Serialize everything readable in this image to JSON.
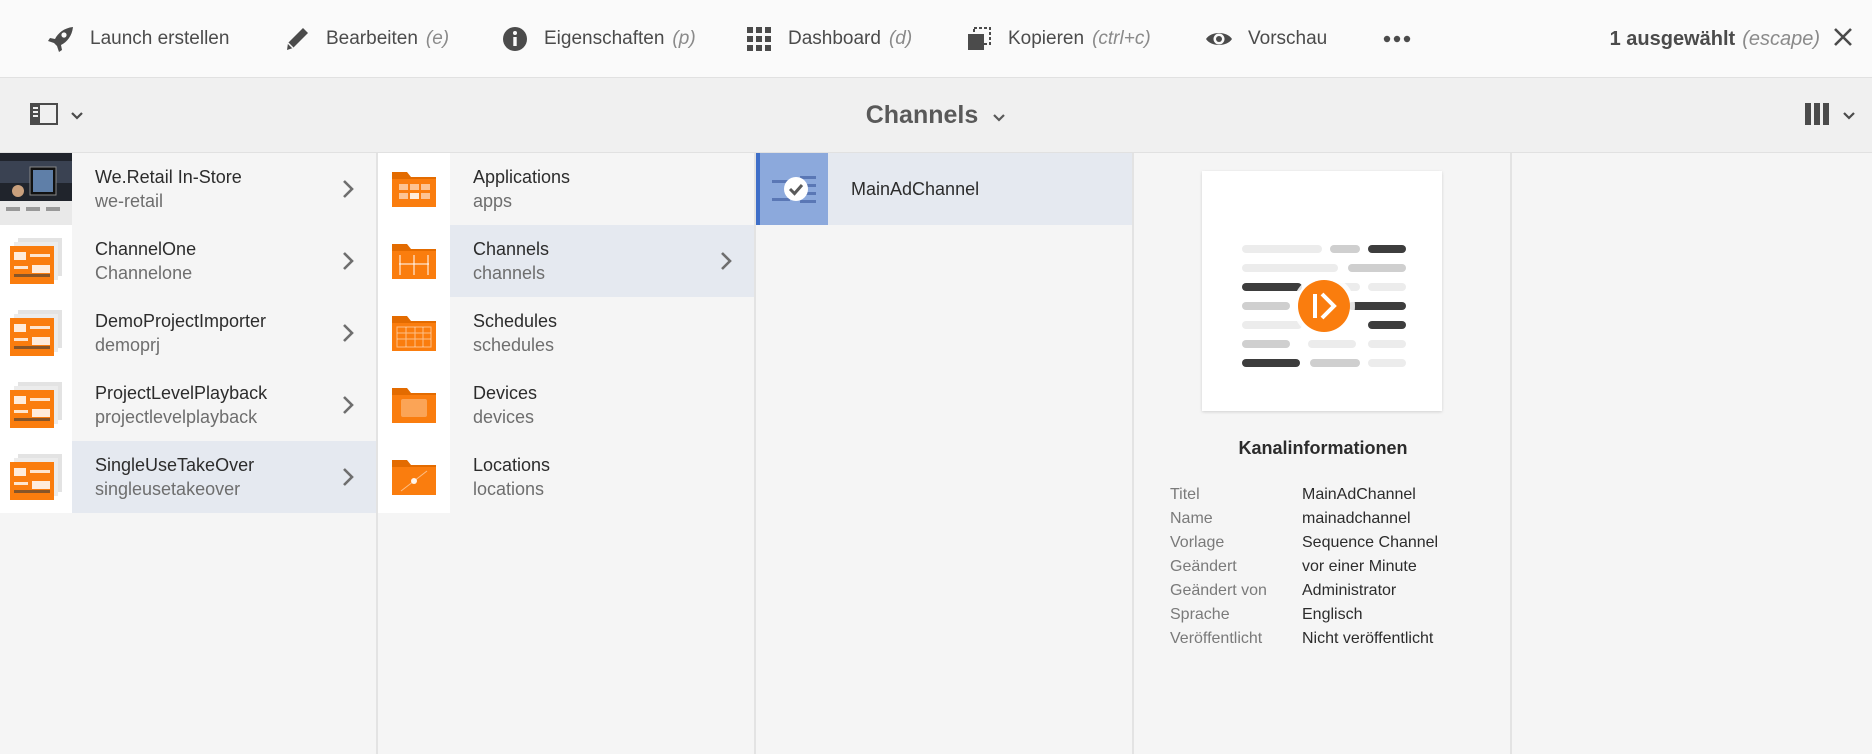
{
  "actionbar": {
    "actions": [
      {
        "label": "Launch erstellen",
        "hint": "",
        "icon": "rocket-icon"
      },
      {
        "label": "Bearbeiten",
        "hint": "(e)",
        "icon": "pencil-icon"
      },
      {
        "label": "Eigenschaften",
        "hint": "(p)",
        "icon": "info-icon"
      },
      {
        "label": "Dashboard",
        "hint": "(d)",
        "icon": "grid-icon"
      },
      {
        "label": "Kopieren",
        "hint": "(ctrl+c)",
        "icon": "copy-icon"
      },
      {
        "label": "Vorschau",
        "hint": "",
        "icon": "eye-icon"
      }
    ],
    "selection_label": "1 ausgewählt",
    "selection_hint": "(escape)"
  },
  "titlebar": {
    "title": "Channels"
  },
  "columns": {
    "projects": [
      {
        "title": "We.Retail In-Store",
        "name": "we-retail"
      },
      {
        "title": "ChannelOne",
        "name": "Channelone"
      },
      {
        "title": "DemoProjectImporter",
        "name": "demoprj"
      },
      {
        "title": "ProjectLevelPlayback",
        "name": "projectlevelplayback"
      },
      {
        "title": "SingleUseTakeOver",
        "name": "singleusetakeover"
      }
    ],
    "folders": [
      {
        "title": "Applications",
        "name": "apps"
      },
      {
        "title": "Channels",
        "name": "channels"
      },
      {
        "title": "Schedules",
        "name": "schedules"
      },
      {
        "title": "Devices",
        "name": "devices"
      },
      {
        "title": "Locations",
        "name": "locations"
      }
    ],
    "channels": [
      {
        "title": "MainAdChannel"
      }
    ]
  },
  "info": {
    "title": "Kanalinformationen",
    "meta": [
      {
        "key": "Titel",
        "value": "MainAdChannel"
      },
      {
        "key": "Name",
        "value": "mainadchannel"
      },
      {
        "key": "Vorlage",
        "value": "Sequence Channel"
      },
      {
        "key": "Geändert",
        "value": "vor einer Minute"
      },
      {
        "key": "Geändert von",
        "value": "Administrator"
      },
      {
        "key": "Sprache",
        "value": "Englisch"
      },
      {
        "key": "Veröffentlicht",
        "value": "Nicht veröffentlicht"
      }
    ]
  },
  "colors": {
    "accent_orange": "#fa7d0e",
    "selection_blue": "#3f6fc8",
    "selected_row": "#e5e9f0"
  }
}
